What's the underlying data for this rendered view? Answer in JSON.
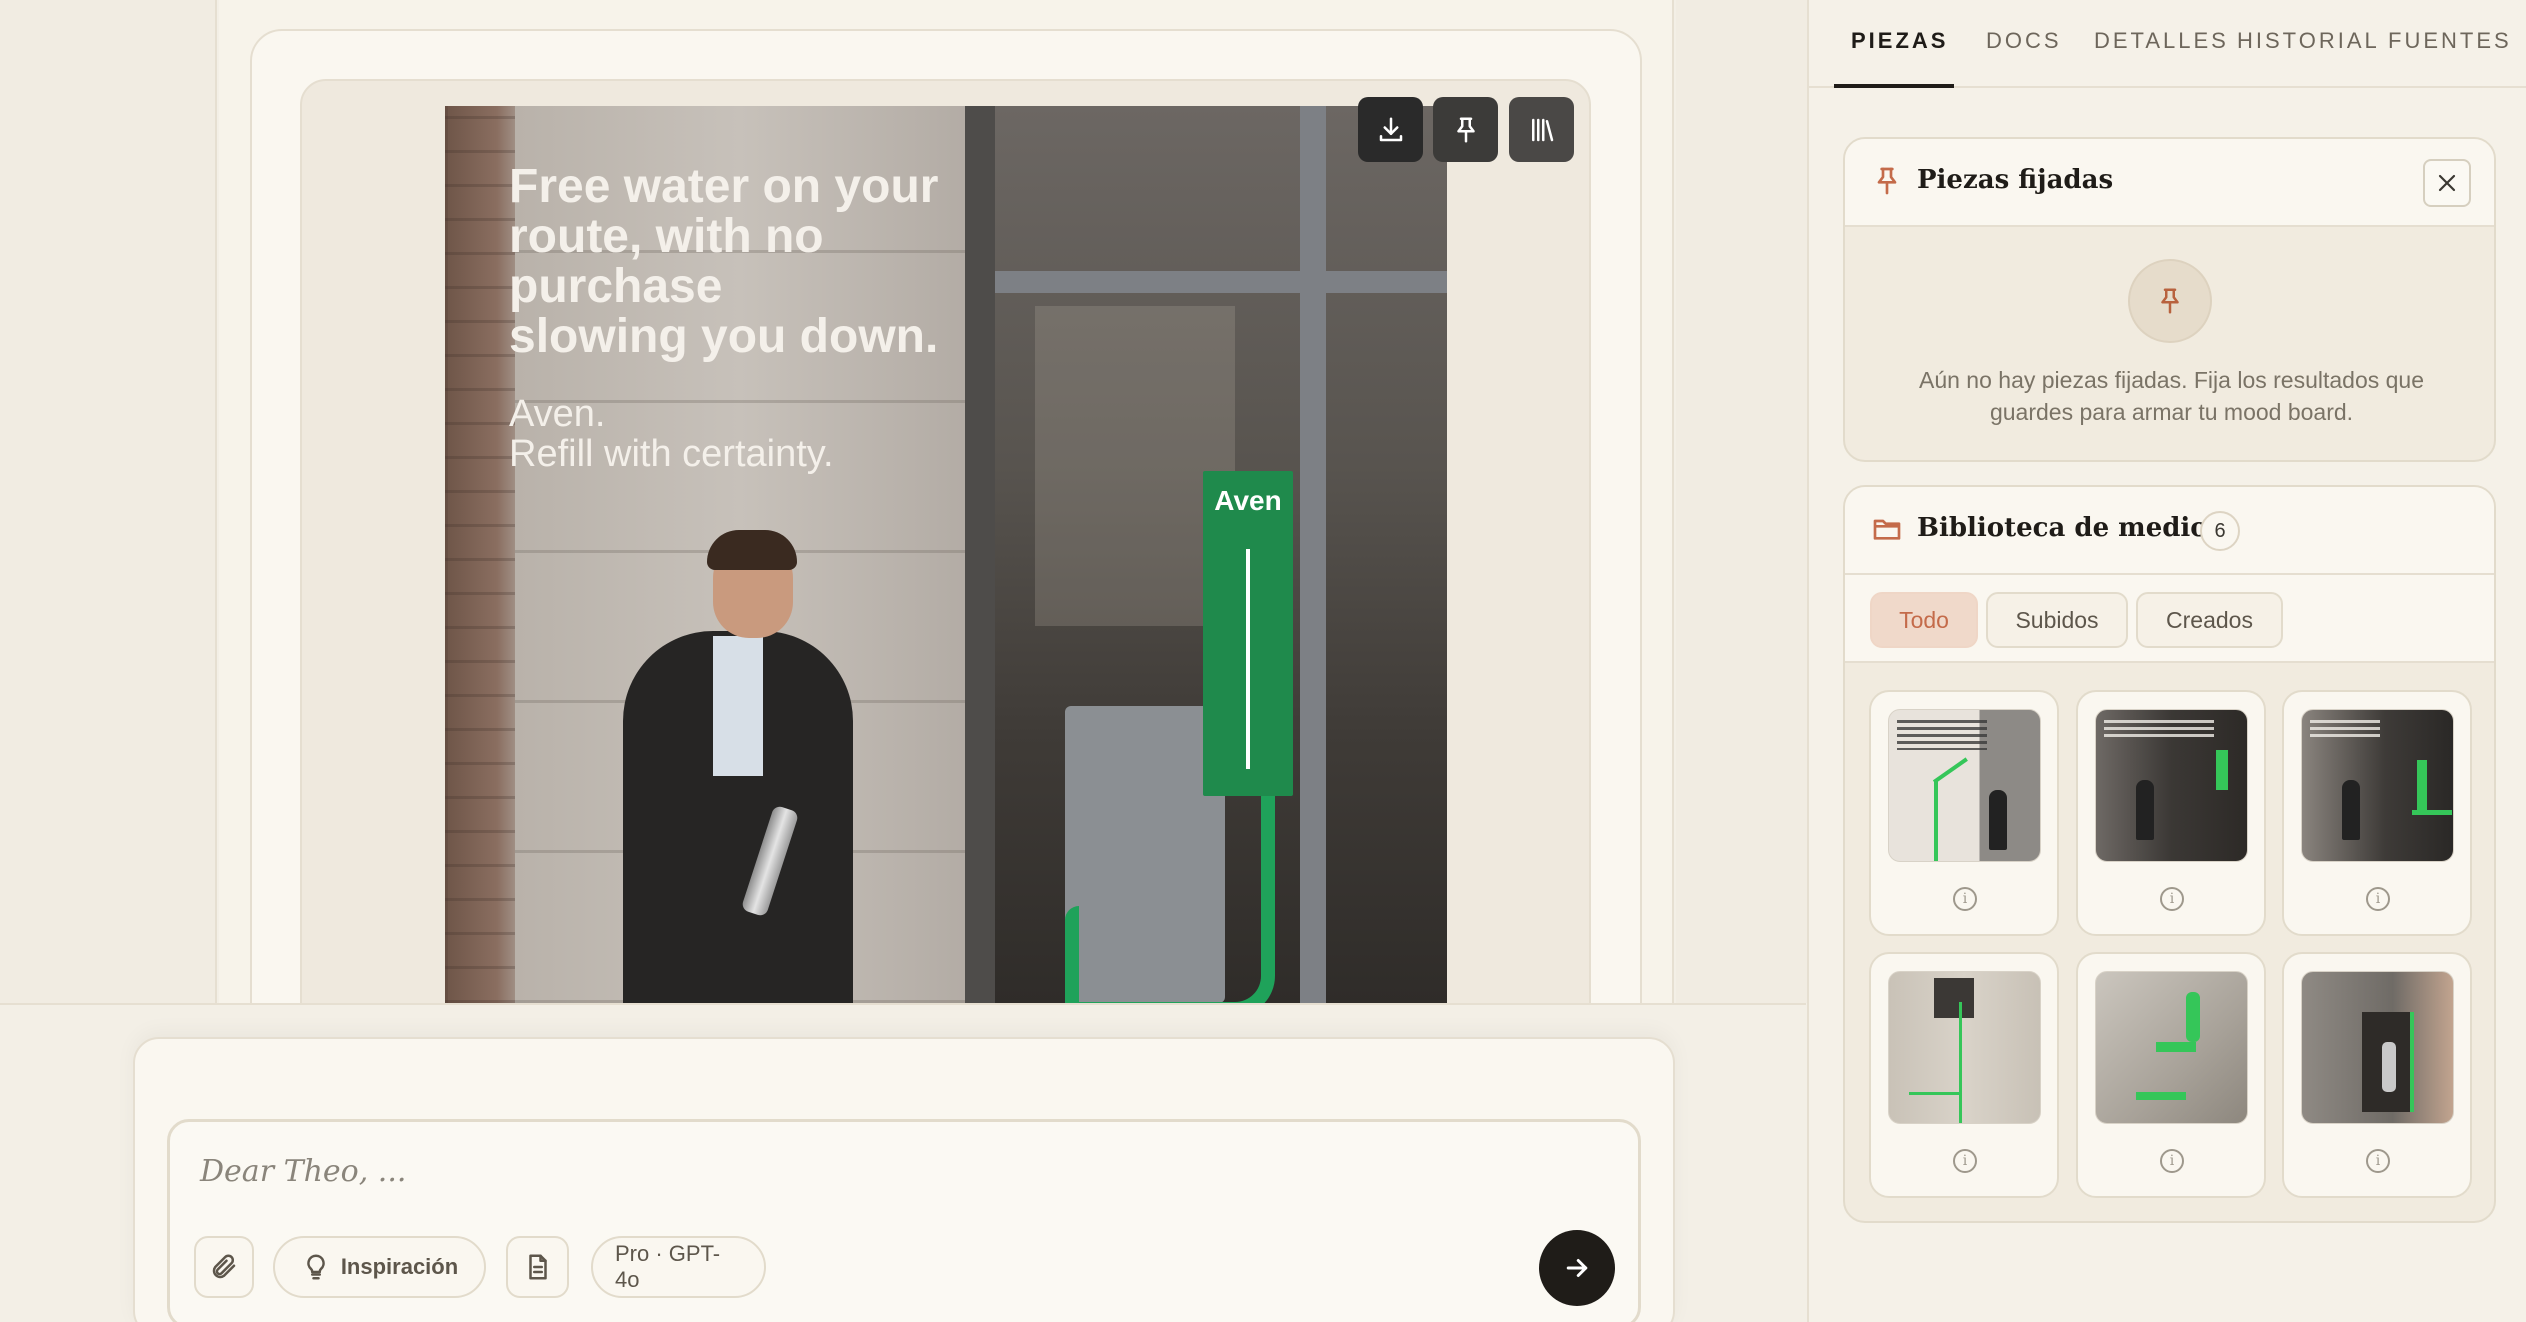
{
  "composer": {
    "placeholder": "Dear Theo, ...",
    "chips": {
      "attach_icon": "paperclip-icon",
      "inspiration_label": "Inspiración",
      "inspiration_icon": "lightbulb-icon",
      "doc_icon": "document-icon",
      "model_label": "Pro · GPT-4o"
    },
    "send_icon": "arrow-right-icon"
  },
  "preview": {
    "headline": "Free water on your\nroute, with no\npurchase\nslowing you down.",
    "tagline": "Aven.\nRefill with certainty.",
    "sign_brand": "Aven",
    "actions": [
      "download-icon",
      "pin-icon",
      "library-icon"
    ]
  },
  "tabs": {
    "items": [
      "PIEZAS",
      "DOCS",
      "DETALLES",
      "HISTORIAL",
      "FUENTES"
    ],
    "active": "PIEZAS"
  },
  "pinned": {
    "title": "Piezas fijadas",
    "empty_text": "Aún no hay piezas fijadas. Fija los resultados que guardes para armar tu mood board."
  },
  "library": {
    "title": "Biblioteca de medios",
    "count": "6",
    "filters": [
      "Todo",
      "Subidos",
      "Creados"
    ],
    "active_filter": "Todo"
  },
  "colors": {
    "accent": "#c46b4a",
    "background": "#f3efe6",
    "dark_button": "#1f1c18",
    "route_green": "#1fa25a"
  }
}
